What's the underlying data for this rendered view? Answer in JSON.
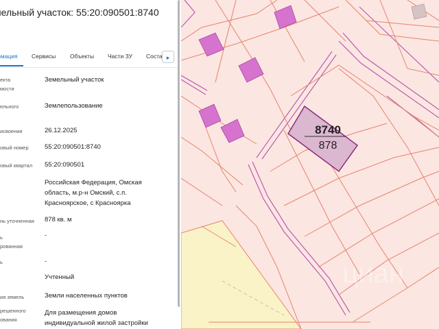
{
  "panel": {
    "title": "мельный участок: 55:20:090501:8740",
    "tabs": [
      {
        "label": "омация",
        "active": true
      },
      {
        "label": "Сервисы",
        "active": false
      },
      {
        "label": "Объекты",
        "active": false
      },
      {
        "label": "Части ЗУ",
        "active": false
      },
      {
        "label": "Соста",
        "active": false
      }
    ],
    "tab_more_icon": "chevron-right-icon",
    "rows": [
      {
        "label": "екта\nмости",
        "value": "Земельный участок"
      },
      {
        "label": "ельного",
        "value": "Землепользование"
      },
      {
        "label": "исвоения",
        "value": "26.12.2025"
      },
      {
        "label": "овый номер",
        "value": "55:20:090501:8740"
      },
      {
        "label": "овый квартал",
        "value": "55:20:090501"
      },
      {
        "label": "",
        "value": "Российская Федерация, Омская область, м.р-н Омский, с.п. Красноярское, с Красноярка"
      },
      {
        "label": "нь уточненная",
        "value": "878 кв. м"
      },
      {
        "label": "ь\nрованная",
        "value": "-"
      },
      {
        "label": "ь",
        "value": "-"
      },
      {
        "label": "",
        "value": "Учтенный"
      },
      {
        "label": "ия земель",
        "value": "Земли населенных пунктов"
      },
      {
        "label": "решенного\nования",
        "value": "Для размещения домов индивидуальной жилой застройки"
      }
    ]
  },
  "map": {
    "parcel_number": "8740",
    "parcel_area": "878",
    "watermark": "циан",
    "colors": {
      "background": "#fbe6e2",
      "parcel_line": "#e8836a",
      "selected_fill": "#dcb7d0",
      "selected_border": "#8a2b7c",
      "building": "#d673cf",
      "road_edge": "#b95cad",
      "yellow_zone": "#faf3c8"
    }
  }
}
